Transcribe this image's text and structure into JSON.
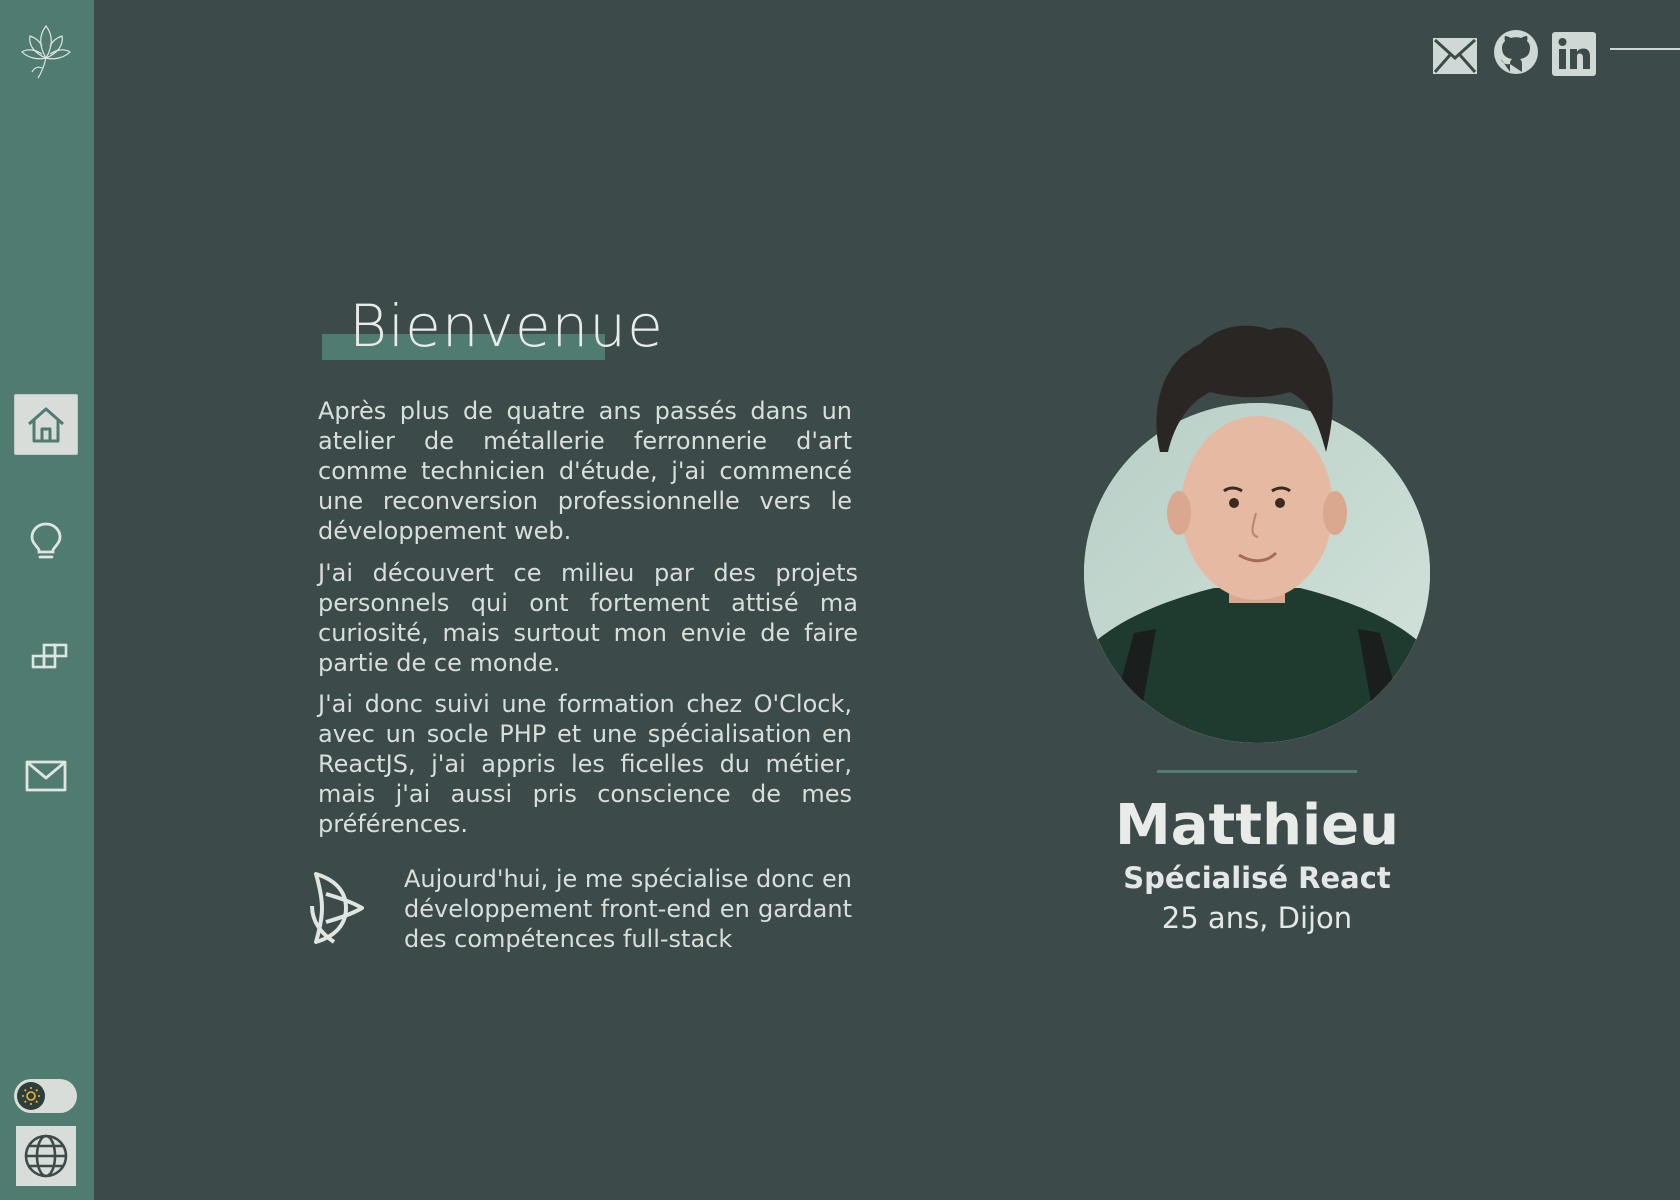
{
  "sidebar": {
    "nav": [
      {
        "icon": "home-icon",
        "active": true
      },
      {
        "icon": "lightbulb-icon",
        "active": false
      },
      {
        "icon": "blocks-icon",
        "active": false
      },
      {
        "icon": "mail-icon",
        "active": false
      }
    ],
    "theme_toggle": {
      "icon": "sun-icon",
      "state": "light"
    },
    "language_icon": "globe-icon"
  },
  "socials": [
    "mail-icon",
    "github-icon",
    "linkedin-icon"
  ],
  "main": {
    "title": "Bienvenue",
    "paragraphs": [
      "Après plus de quatre ans passés dans un atelier de métallerie ferronnerie d'art comme technicien d'étude, j'ai commencé une reconversion professionnelle vers le développement web.",
      "J'ai découvert ce milieu par des projets personnels qui ont fortement attisé ma curiosité, mais surtout mon envie de faire partie de ce monde.",
      "J'ai donc suivi une formation chez O'Clock, avec un socle PHP et une spécialisation en ReactJS, j'ai appris les ficelles du métier, mais j'ai aussi pris conscience de mes préférences.",
      "Aujourd'hui, je me spécialise donc en développement front-end en gardant des compétences full-stack"
    ]
  },
  "profile": {
    "name": "Matthieu",
    "specialty": "Spécialisé React",
    "age_city": "25 ans, Dijon"
  },
  "colors": {
    "background": "#3c4b49",
    "sidebar": "#4f7b70",
    "accent": "#4f7b70",
    "text": "#e6e8e6"
  }
}
